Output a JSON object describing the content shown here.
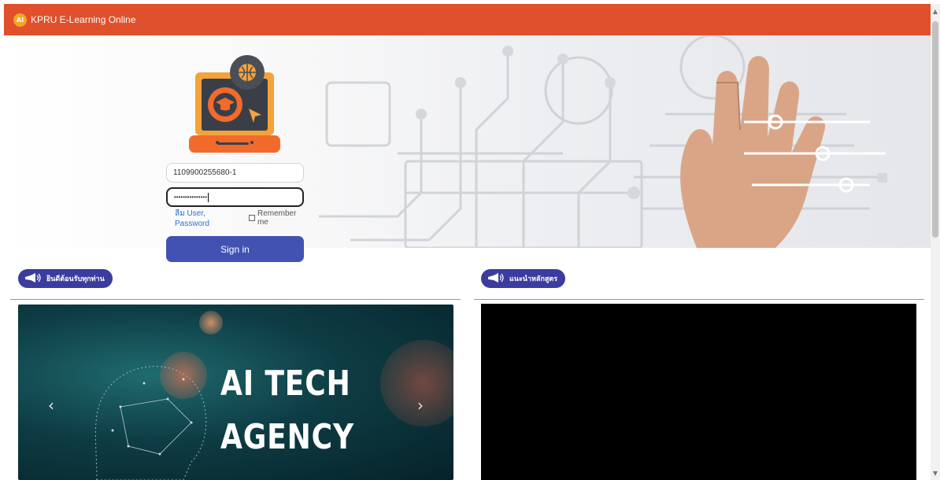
{
  "header": {
    "logo_text": "AI",
    "title": "KPRU E-Learning Online"
  },
  "login": {
    "username_value": "1109900255680-1",
    "password_value": "•••••••••••••••",
    "forgot_label": "ลืม User, Password",
    "remember_label": "Remember me",
    "remember_checked": false,
    "signin_label": "Sign in"
  },
  "sections": {
    "welcome_title": "ยินดีต้อนรับทุกท่าน",
    "courses_title": "แนะนำหลักสูตร"
  },
  "carousel": {
    "headline_line1": "AI TECH",
    "headline_line2": "AGENCY",
    "prev_icon": "‹",
    "next_icon": "›"
  },
  "colors": {
    "header_bg": "#e0502c",
    "button_bg": "#4252b3",
    "pill_bg": "#3b3d9e"
  }
}
